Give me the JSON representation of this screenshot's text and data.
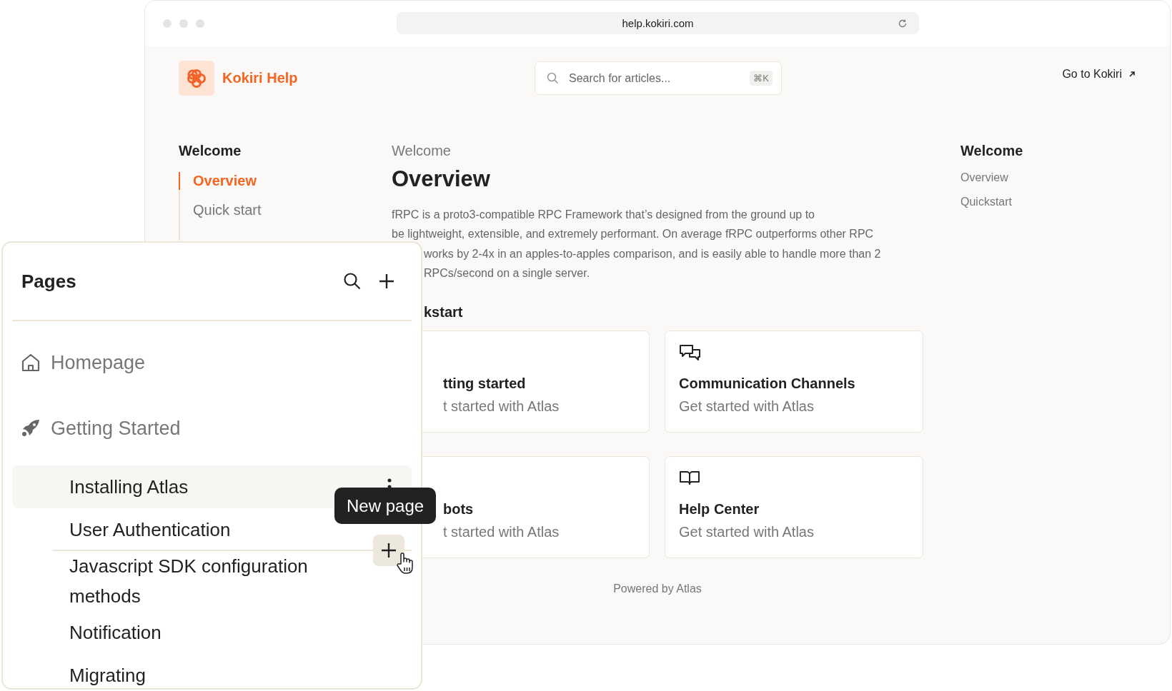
{
  "browser": {
    "url": "help.kokiri.com"
  },
  "header": {
    "brand": "Kokiri Help",
    "search": {
      "placeholder": "Search for articles...",
      "shortcut": "⌘K"
    },
    "external_link": "Go to Kokiri"
  },
  "left_nav": {
    "heading": "Welcome",
    "items": [
      {
        "label": "Overview",
        "selected": true
      },
      {
        "label": "Quick start",
        "selected": false
      }
    ]
  },
  "article": {
    "breadcrumb": "Welcome",
    "title": "Overview",
    "lines": [
      "fRPC is a proto3-compatible RPC Framework that’s designed from the ground up to",
      "be lightweight, extensible, and extremely performant. On average fRPC outperforms other RPC"
    ],
    "partial_lines": [
      "works by 2-4x in an apples-to-apples comparison, and is easily able to handle more than 2",
      "RPCs/second on a single server."
    ],
    "section_heading": "kstart",
    "cards": [
      {
        "kind": "covered",
        "title": "tting started",
        "subtitle": "t started with Atlas"
      },
      {
        "kind": "chat",
        "title": "Communication Channels",
        "subtitle": "Get started with Atlas"
      },
      {
        "kind": "covered",
        "title": "bots",
        "subtitle": "t started with Atlas"
      },
      {
        "kind": "book",
        "title": "Help Center",
        "subtitle": "Get started with Atlas"
      }
    ],
    "footer": "Powered by Atlas"
  },
  "toc": {
    "heading": "Welcome",
    "items": [
      "Overview",
      "Quickstart"
    ]
  },
  "pages_panel": {
    "title": "Pages",
    "tooltip": "New page",
    "sections": [
      {
        "kind": "home",
        "label": "Homepage"
      },
      {
        "kind": "rocket",
        "label": "Getting Started",
        "children": [
          {
            "label": "Installing Atlas",
            "selected": true
          },
          {
            "label": "User Authentication",
            "selected": false
          },
          {
            "label": "Javascript SDK configuration methods",
            "selected": false
          },
          {
            "label": "Notification",
            "selected": false
          },
          {
            "label": "Migrating",
            "selected": false
          }
        ]
      }
    ]
  }
}
